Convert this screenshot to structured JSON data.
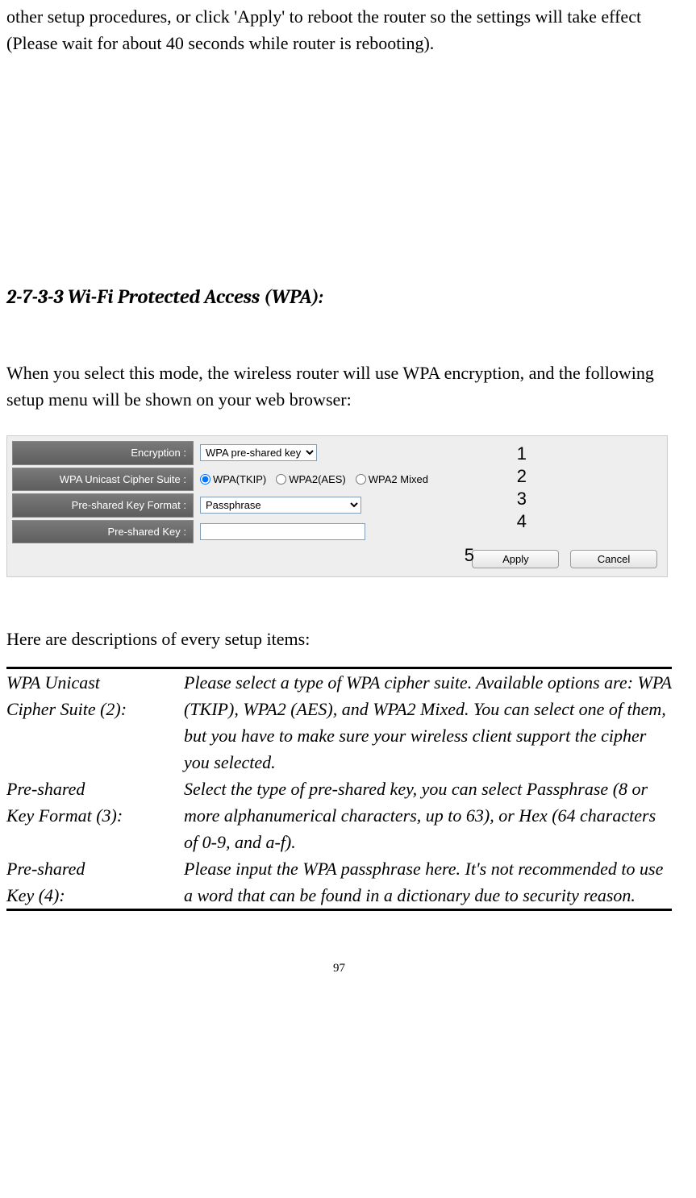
{
  "intro_para": "other setup procedures, or click 'Apply' to reboot the router so the settings will take effect (Please wait for about 40 seconds while router is rebooting).",
  "section_heading": "2-7-3-3 Wi-Fi Protected Access (WPA):",
  "mode_para": "When you select this mode, the wireless router will use WPA encryption, and the following setup menu will be shown on your web browser:",
  "panel": {
    "labels": {
      "encryption": "Encryption :",
      "cipher": "WPA Unicast Cipher Suite :",
      "format": "Pre-shared Key Format :",
      "key": "Pre-shared Key :"
    },
    "encryption_value": "WPA pre-shared key",
    "cipher_options": {
      "tkip": "WPA(TKIP)",
      "aes": "WPA2(AES)",
      "mixed": "WPA2 Mixed"
    },
    "format_value": "Passphrase",
    "key_value": "",
    "buttons": {
      "apply": "Apply",
      "cancel": "Cancel"
    }
  },
  "callouts": {
    "c1": "1",
    "c2": "2",
    "c3": "3",
    "c4": "4",
    "c5": "5"
  },
  "desc_intro": "Here are descriptions of every setup items:",
  "table": {
    "row1": {
      "k1": "WPA Unicast",
      "k2": "Cipher Suite (2):",
      "v": "Please select a type of WPA cipher suite. Available options are: WPA (TKIP), WPA2 (AES), and WPA2 Mixed. You can select one of them, but you have to make sure your wireless client support the cipher you selected."
    },
    "row2": {
      "k1": "Pre-shared",
      "k2": "Key Format (3):",
      "v": "Select the type of pre-shared key, you can select Passphrase (8 or more alphanumerical characters, up to 63), or Hex (64 characters of 0-9, and a-f)."
    },
    "row3": {
      "k1": "Pre-shared",
      "k2": "Key (4):",
      "v": "Please input the WPA passphrase here. It's not recommended to use a word that can be found in a dictionary due to security reason."
    }
  },
  "page_number": "97"
}
